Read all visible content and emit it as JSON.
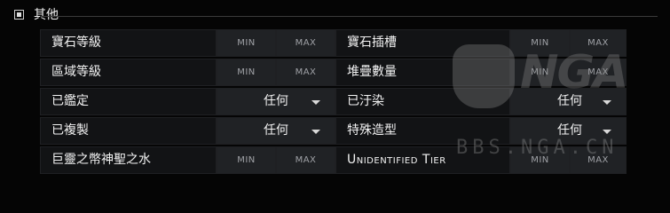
{
  "section": {
    "title": "其他",
    "checked": true
  },
  "placeholders": {
    "min": "MIN",
    "max": "MAX"
  },
  "left": [
    {
      "label": "寶石等級",
      "kind": "range"
    },
    {
      "label": "區域等級",
      "kind": "range"
    },
    {
      "label": "已鑑定",
      "kind": "select",
      "value": "任何"
    },
    {
      "label": "已複製",
      "kind": "select",
      "value": "任何"
    },
    {
      "label": "巨靈之幣神聖之水",
      "kind": "range"
    }
  ],
  "right": [
    {
      "label": "寶石插槽",
      "kind": "range"
    },
    {
      "label": "堆疊數量",
      "kind": "range"
    },
    {
      "label": "已汙染",
      "kind": "select",
      "value": "任何"
    },
    {
      "label": "特殊造型",
      "kind": "select",
      "value": "任何"
    },
    {
      "label": "Unidentified Tier",
      "kind": "range"
    }
  ],
  "watermark": {
    "logo": "NGA",
    "site": "BBS.NGA.CN",
    "icon": "bear-paw-icon"
  }
}
